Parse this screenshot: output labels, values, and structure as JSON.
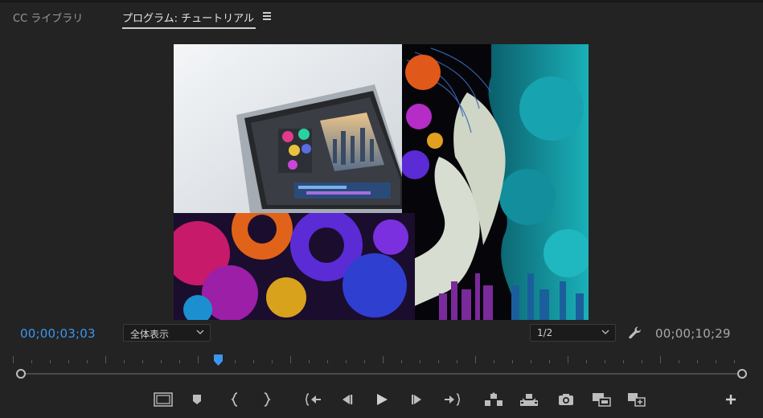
{
  "tabs": {
    "cc_library": "CC ライブラリ",
    "program": "プログラム: チュートリアル"
  },
  "icons": {
    "panel_menu": "hamburger-menu-icon",
    "settings": "wrench-icon"
  },
  "monitor": {
    "current_timecode": "00;00;03;03",
    "duration_timecode": "00;00;10;29",
    "zoom_select": "全体表示",
    "resolution_select": "1/2",
    "playhead_position": 0.28
  },
  "controls": [
    "safe-margins-icon",
    "add-marker-icon",
    "mark-in-icon",
    "mark-out-icon",
    "go-to-in-icon",
    "step-back-icon",
    "play-icon",
    "step-forward-icon",
    "go-to-out-icon",
    "lift-icon",
    "extract-icon",
    "export-frame-icon",
    "comparison-view-icon",
    "proxy-toggle-icon",
    "button-editor-icon"
  ],
  "colors": {
    "accent": "#3d95f2",
    "background": "#232323"
  }
}
